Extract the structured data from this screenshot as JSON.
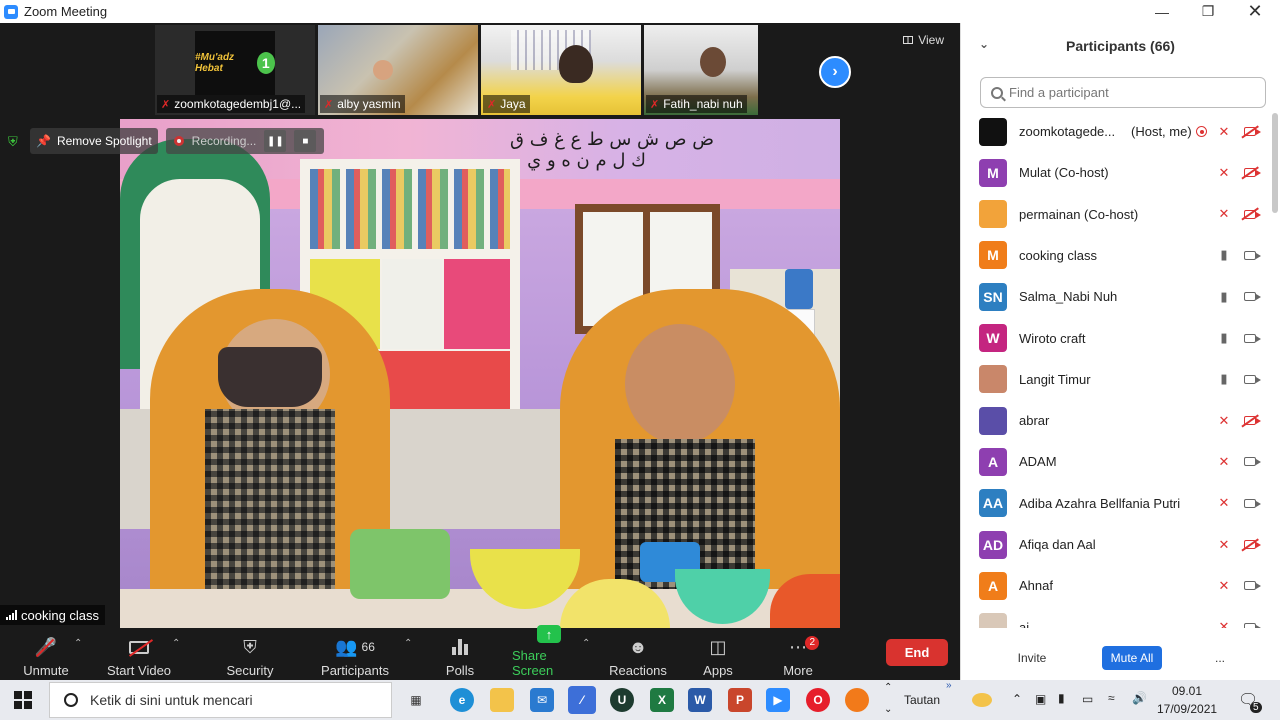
{
  "window": {
    "title": "Zoom Meeting"
  },
  "thumbnails": [
    {
      "name": "zoomkotagedembj1@...",
      "logo_text": "#Mu'adz Hebat"
    },
    {
      "name": "alby yasmin"
    },
    {
      "name": "Jaya"
    },
    {
      "name": "Fatih_nabi nuh"
    }
  ],
  "view_label": "View",
  "overlay": {
    "remove_spotlight": "Remove Spotlight",
    "recording": "Recording...",
    "speaker_name": "cooking class"
  },
  "toolbar": {
    "unmute": "Unmute",
    "start_video": "Start Video",
    "security": "Security",
    "participants": "Participants",
    "participants_count": "66",
    "polls": "Polls",
    "share_screen": "Share Screen",
    "reactions": "Reactions",
    "apps": "Apps",
    "more": "More",
    "more_badge": "2",
    "end": "End"
  },
  "panel": {
    "title": "Participants (66)",
    "search_placeholder": "Find a participant",
    "participants": [
      {
        "initials": "",
        "name": "zoomkotagede...",
        "tag": "(Host, me)",
        "color": "#111111",
        "recording": true,
        "mic": "muted",
        "cam": "off"
      },
      {
        "initials": "M",
        "name": "Mulat (Co-host)",
        "tag": "",
        "color": "#8e3fb0",
        "mic": "muted",
        "cam": "off"
      },
      {
        "initials": "",
        "name": "permainan (Co-host)",
        "tag": "",
        "color": "#f2a33a",
        "mic": "muted",
        "cam": "off"
      },
      {
        "initials": "M",
        "name": "cooking class",
        "tag": "",
        "color": "#f07d1a",
        "mic": "live",
        "cam": "on"
      },
      {
        "initials": "SN",
        "name": "Salma_Nabi Nuh",
        "tag": "",
        "color": "#2d7fc1",
        "mic": "live",
        "cam": "on"
      },
      {
        "initials": "W",
        "name": "Wiroto craft",
        "tag": "",
        "color": "#c42580",
        "mic": "live",
        "cam": "on"
      },
      {
        "initials": "",
        "name": "Langit Timur",
        "tag": "",
        "color": "#c9876a",
        "mic": "live",
        "cam": "on"
      },
      {
        "initials": "",
        "name": "abrar",
        "tag": "",
        "color": "#5a4ea8",
        "mic": "muted",
        "cam": "off"
      },
      {
        "initials": "A",
        "name": "ADAM",
        "tag": "",
        "color": "#8e3fb0",
        "mic": "muted",
        "cam": "on"
      },
      {
        "initials": "AA",
        "name": "Adiba Azahra Bellfania Putri",
        "tag": "",
        "color": "#2d7fc1",
        "mic": "muted",
        "cam": "on"
      },
      {
        "initials": "AD",
        "name": "Afiqa dan Aal",
        "tag": "",
        "color": "#8e3fb0",
        "mic": "muted",
        "cam": "off"
      },
      {
        "initials": "A",
        "name": "Ahnaf",
        "tag": "",
        "color": "#f07d1a",
        "mic": "muted",
        "cam": "on"
      },
      {
        "initials": "",
        "name": "ai...",
        "tag": "",
        "color": "#d9c8b8",
        "mic": "muted",
        "cam": "on"
      }
    ],
    "invite": "Invite",
    "mute_all": "Mute All",
    "more": "..."
  },
  "taskbar": {
    "search_placeholder": "Ketik di sini untuk mencari",
    "tautan": "Tautan",
    "time": "09.01",
    "date": "17/09/2021",
    "notification_count": "5"
  }
}
